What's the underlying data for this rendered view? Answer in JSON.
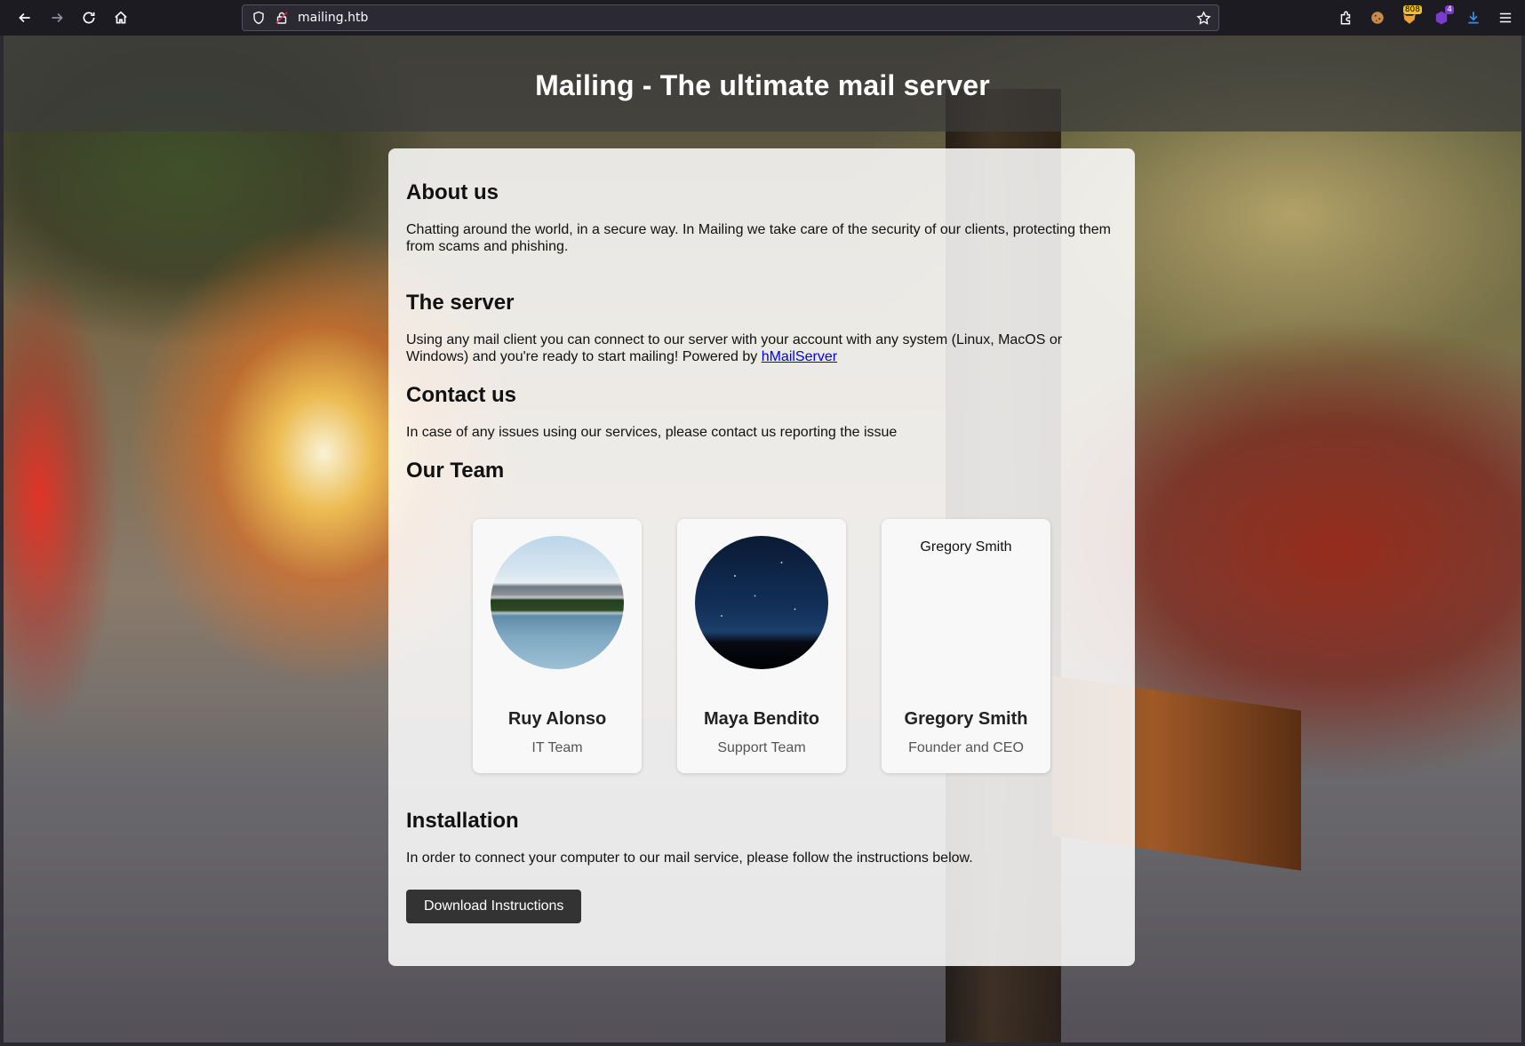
{
  "browser": {
    "url": "mailing.htb",
    "badges": {
      "extension_count": "808",
      "extension2_count": "4"
    }
  },
  "header": {
    "title": "Mailing - The ultimate mail server"
  },
  "about": {
    "heading": "About us",
    "text": "Chatting around the world, in a secure way. In Mailing we take care of the security of our clients, protecting them from scams and phishing."
  },
  "server": {
    "heading": "The server",
    "text": "Using any mail client you can connect to our server with your account with any system (Linux, MacOS or Windows) and you're ready to start mailing! Powered by ",
    "link_text": "hMailServer"
  },
  "contact": {
    "heading": "Contact us",
    "text": "In case of any issues using our services, please contact us reporting the issue"
  },
  "team": {
    "heading": "Our Team",
    "members": [
      {
        "name": "Ruy Alonso",
        "role": "IT Team"
      },
      {
        "name": "Maya Bendito",
        "role": "Support Team"
      },
      {
        "name": "Gregory Smith",
        "role": "Founder and CEO",
        "img_alt": "Gregory Smith"
      }
    ]
  },
  "installation": {
    "heading": "Installation",
    "text": "In order to connect your computer to our mail service, please follow the instructions below.",
    "button_label": "Download Instructions"
  },
  "colors": {
    "button_bg": "#333333",
    "link": "#0000ee",
    "header_overlay": "rgba(60,60,60,0.72)"
  }
}
